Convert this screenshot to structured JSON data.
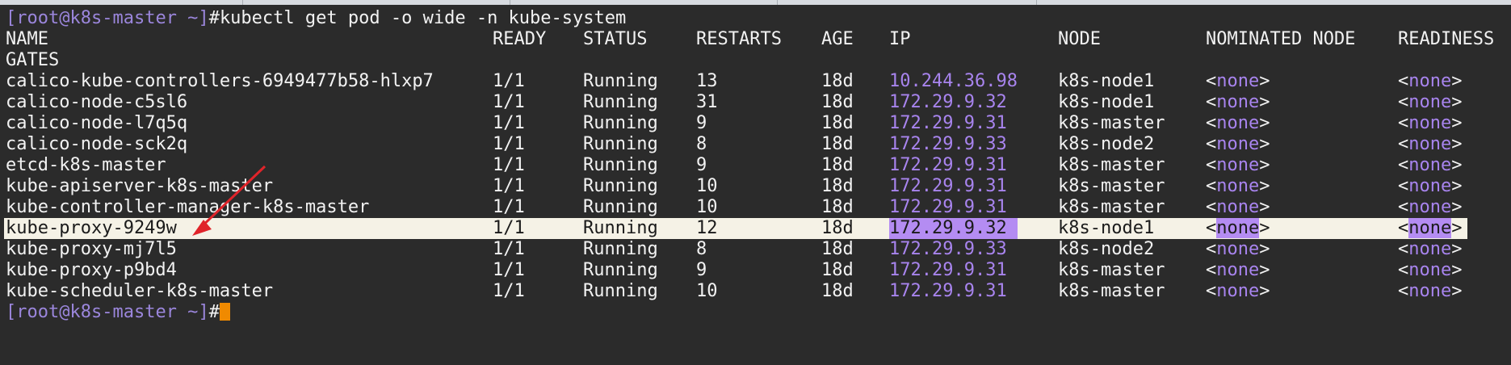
{
  "prompt": {
    "open": "[",
    "user": "root",
    "at": "@",
    "host": "k8s-master",
    "path": " ~",
    "close": "]",
    "symbol": "#"
  },
  "command": "kubectl get pod -o wide -n kube-system",
  "headers": {
    "name": "NAME",
    "ready": "READY",
    "status": "STATUS",
    "restarts": "RESTARTS",
    "age": "AGE",
    "ip": "IP",
    "node": "NODE",
    "nominated": "NOMINATED NODE",
    "readiness": "READINESS",
    "gates": "GATES"
  },
  "rows": [
    {
      "name": "calico-kube-controllers-6949477b58-hlxp7",
      "ready": "1/1",
      "status": "Running",
      "restarts": "13",
      "age": "18d",
      "ip": "10.244.36.98",
      "node": "k8s-node1",
      "nominated": "none",
      "readiness": "none"
    },
    {
      "name": "calico-node-c5sl6",
      "ready": "1/1",
      "status": "Running",
      "restarts": "31",
      "age": "18d",
      "ip": "172.29.9.32",
      "node": "k8s-node1",
      "nominated": "none",
      "readiness": "none"
    },
    {
      "name": "calico-node-l7q5q",
      "ready": "1/1",
      "status": "Running",
      "restarts": "9",
      "age": "18d",
      "ip": "172.29.9.31",
      "node": "k8s-master",
      "nominated": "none",
      "readiness": "none"
    },
    {
      "name": "calico-node-sck2q",
      "ready": "1/1",
      "status": "Running",
      "restarts": "8",
      "age": "18d",
      "ip": "172.29.9.33",
      "node": "k8s-node2",
      "nominated": "none",
      "readiness": "none"
    },
    {
      "name": "etcd-k8s-master",
      "ready": "1/1",
      "status": "Running",
      "restarts": "9",
      "age": "18d",
      "ip": "172.29.9.31",
      "node": "k8s-master",
      "nominated": "none",
      "readiness": "none"
    },
    {
      "name": "kube-apiserver-k8s-master",
      "ready": "1/1",
      "status": "Running",
      "restarts": "10",
      "age": "18d",
      "ip": "172.29.9.31",
      "node": "k8s-master",
      "nominated": "none",
      "readiness": "none"
    },
    {
      "name": "kube-controller-manager-k8s-master",
      "ready": "1/1",
      "status": "Running",
      "restarts": "10",
      "age": "18d",
      "ip": "172.29.9.31",
      "node": "k8s-master",
      "nominated": "none",
      "readiness": "none"
    },
    {
      "name": "kube-proxy-9249w",
      "ready": "1/1",
      "status": "Running",
      "restarts": "12",
      "age": "18d",
      "ip": "172.29.9.32",
      "node": "k8s-node1",
      "nominated": "none",
      "readiness": "none",
      "highlighted": true
    },
    {
      "name": "kube-proxy-mj7l5",
      "ready": "1/1",
      "status": "Running",
      "restarts": "8",
      "age": "18d",
      "ip": "172.29.9.33",
      "node": "k8s-node2",
      "nominated": "none",
      "readiness": "none"
    },
    {
      "name": "kube-proxy-p9bd4",
      "ready": "1/1",
      "status": "Running",
      "restarts": "9",
      "age": "18d",
      "ip": "172.29.9.31",
      "node": "k8s-master",
      "nominated": "none",
      "readiness": "none"
    },
    {
      "name": "kube-scheduler-k8s-master",
      "ready": "1/1",
      "status": "Running",
      "restarts": "10",
      "age": "18d",
      "ip": "172.29.9.31",
      "node": "k8s-master",
      "nominated": "none",
      "readiness": "none"
    }
  ],
  "colors": {
    "background": "#2b2b2b",
    "text": "#f2f2f2",
    "prompt": "#9b86dc",
    "ip_text": "#a884ee",
    "highlight_row": "#f5f2e6",
    "highlight_mark": "#b48cf2",
    "cursor": "#f08a00",
    "arrow": "#e0242a"
  },
  "annotation": {
    "arrow_icon": "red-arrow-icon"
  }
}
